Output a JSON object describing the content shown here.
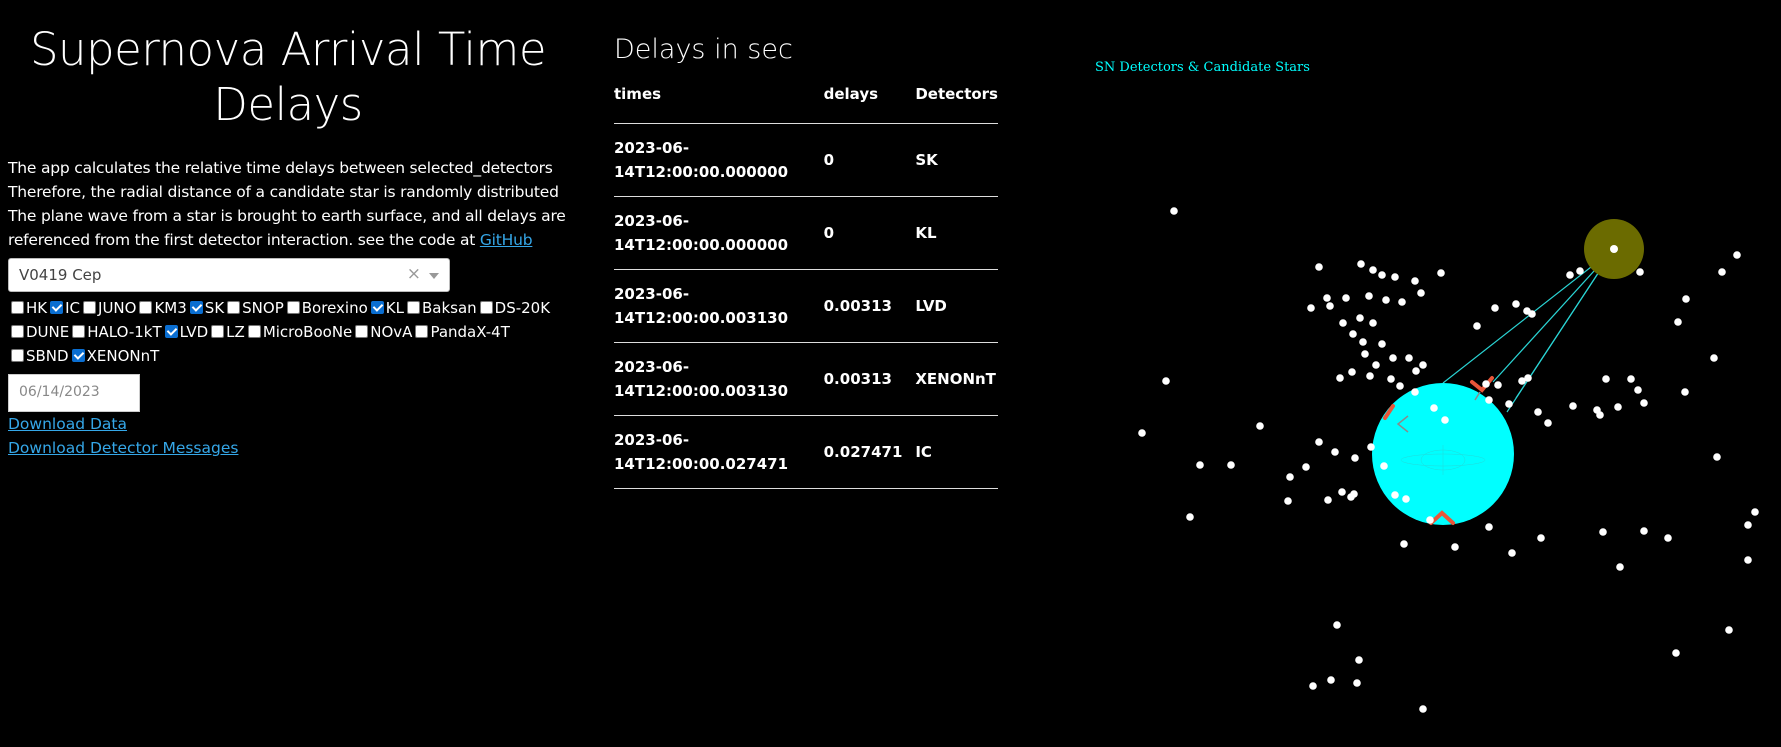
{
  "app": {
    "title": "Supernova Arrival Time Delays",
    "intro_text": "The app calculates the relative time delays between selected_detectors Therefore, the radial distance of a candidate star is randomly distributed The plane wave from a star is brought to earth surface, and all delays are referenced from the first detector interaction. see the code at ",
    "github_link": "GitHub"
  },
  "star_select": {
    "value": "V0419 Cep",
    "clear_symbol": "×"
  },
  "detectors": [
    {
      "name": "HK",
      "checked": false
    },
    {
      "name": "IC",
      "checked": true
    },
    {
      "name": "JUNO",
      "checked": false
    },
    {
      "name": "KM3",
      "checked": false
    },
    {
      "name": "SK",
      "checked": true
    },
    {
      "name": "SNOP",
      "checked": false
    },
    {
      "name": "Borexino",
      "checked": false
    },
    {
      "name": "KL",
      "checked": true
    },
    {
      "name": "Baksan",
      "checked": false
    },
    {
      "name": "DS-20K",
      "checked": false
    },
    {
      "name": "DUNE",
      "checked": false
    },
    {
      "name": "HALO-1kT",
      "checked": false
    },
    {
      "name": "LVD",
      "checked": true
    },
    {
      "name": "LZ",
      "checked": false
    },
    {
      "name": "MicroBooNe",
      "checked": false
    },
    {
      "name": "NOvA",
      "checked": false
    },
    {
      "name": "PandaX-4T",
      "checked": false
    },
    {
      "name": "SBND",
      "checked": false
    },
    {
      "name": "XENONnT",
      "checked": true
    }
  ],
  "date_input": {
    "value": "06/14/2023"
  },
  "downloads": {
    "data": "Download Data",
    "messages": "Download Detector Messages"
  },
  "delays_table": {
    "title": "Delays in sec",
    "headers": [
      "times",
      "delays",
      "Detectors"
    ],
    "rows": [
      {
        "time_line1": "2023-06-",
        "time_line2": "14T12:00:00.000000",
        "delay": "0",
        "detector": "SK"
      },
      {
        "time_line1": "2023-06-",
        "time_line2": "14T12:00:00.000000",
        "delay": "0",
        "detector": "KL"
      },
      {
        "time_line1": "2023-06-",
        "time_line2": "14T12:00:00.003130",
        "delay": "0.00313",
        "detector": "LVD"
      },
      {
        "time_line1": "2023-06-",
        "time_line2": "14T12:00:00.003130",
        "delay": "0.00313",
        "detector": "XENONnT"
      },
      {
        "time_line1": "2023-06-",
        "time_line2": "14T12:00:00.027471",
        "delay": "0.027471",
        "detector": "IC"
      }
    ]
  },
  "plot": {
    "title": "SN Detectors & Candidate Stars",
    "earth_color": "#00ffff",
    "selected_star_halo_color": "#6b6b00",
    "star_color": "#ffffff",
    "detector_marker_color": "#e8563a",
    "ray_color": "#2ad4d4"
  }
}
